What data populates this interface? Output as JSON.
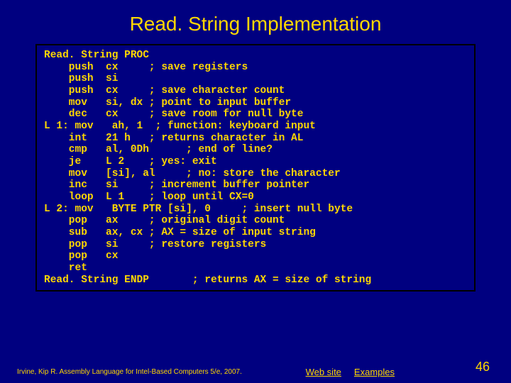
{
  "title": "Read. String Implementation",
  "code": "Read. String PROC\n    push  cx     ; save registers\n    push  si\n    push  cx     ; save character count\n    mov   si, dx ; point to input buffer\n    dec   cx     ; save room for null byte\nL 1: mov   ah, 1  ; function: keyboard input\n    int   21 h   ; returns character in AL\n    cmp   al, 0Dh      ; end of line?\n    je    L 2    ; yes: exit\n    mov   [si], al     ; no: store the character\n    inc   si     ; increment buffer pointer\n    loop  L 1    ; loop until CX=0\nL 2: mov   BYTE PTR [si], 0     ; insert null byte\n    pop   ax     ; original digit count\n    sub   ax, cx ; AX = size of input string\n    pop   si     ; restore registers\n    pop   cx\n    ret\nRead. String ENDP       ; returns AX = size of string",
  "footer": {
    "citation": "Irvine, Kip R. Assembly Language for Intel-Based Computers 5/e, 2007.",
    "link1": "Web site",
    "link2": "Examples",
    "page": "46"
  }
}
